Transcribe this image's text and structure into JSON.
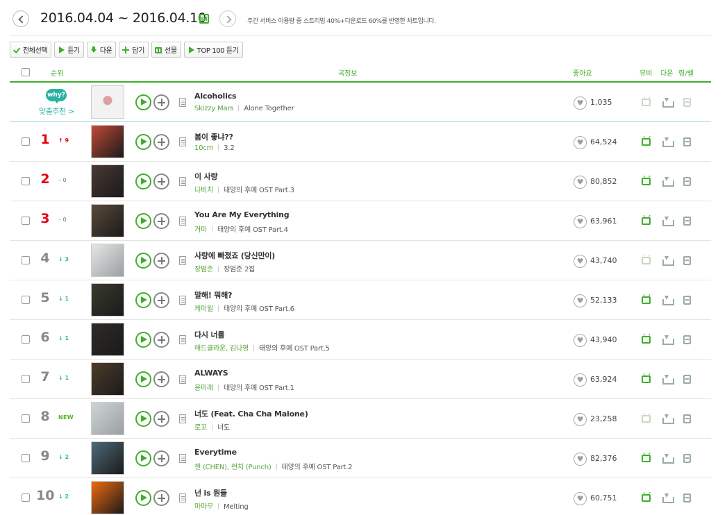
{
  "header": {
    "date_range": "2016.04.04 ~ 2016.04.10",
    "notice": "주간 서비스 이용량 중 스트리밍 40%+다운로드 60%를 반영한 차트입니다."
  },
  "toolbar": {
    "select_all": "전체선택",
    "listen": "듣기",
    "download": "다운",
    "add": "담기",
    "gift": "선물",
    "top100": "TOP 100 듣기"
  },
  "columns": {
    "rank": "순위",
    "song_info": "곡정보",
    "likes": "좋아요",
    "mv": "뮤비",
    "download": "다운",
    "ring": "링/벨"
  },
  "recommendation": {
    "why": "why?",
    "label": "맞춤추천 >",
    "title": "Alcoholics",
    "artist": "Skizzy Mars",
    "album": "Alone Together",
    "likes": "1,035",
    "mv_available": false
  },
  "songs": [
    {
      "rank": "1",
      "change": "9",
      "direction": "up",
      "title": "봄이 좋냐??",
      "artist": "10cm",
      "album": "3.2",
      "likes": "64,524",
      "mv_available": true,
      "art_color": "#c14a37"
    },
    {
      "rank": "2",
      "change": "0",
      "direction": "same",
      "title": "이 사랑",
      "artist": "다비치",
      "album": "태양의 후예 OST Part.3",
      "likes": "80,852",
      "mv_available": true,
      "art_color": "#4a3a36"
    },
    {
      "rank": "3",
      "change": "0",
      "direction": "same",
      "title": "You Are My Everything",
      "artist": "거미",
      "album": "태양의 후예 OST Part.4",
      "likes": "63,961",
      "mv_available": true,
      "art_color": "#5b4a3a"
    },
    {
      "rank": "4",
      "change": "3",
      "direction": "down",
      "title": "사랑에 빠졌죠 (당신만이)",
      "artist": "장범준",
      "album": "장범준 2집",
      "likes": "43,740",
      "mv_available": false,
      "art_color": "#e6e6e6"
    },
    {
      "rank": "5",
      "change": "1",
      "direction": "down",
      "title": "말해! 뭐해?",
      "artist": "케이윌",
      "album": "태양의 후예 OST Part.6",
      "likes": "52,133",
      "mv_available": true,
      "art_color": "#3a3a2e"
    },
    {
      "rank": "6",
      "change": "1",
      "direction": "down",
      "title": "다시 너를",
      "artist": "매드클라운, 김나영",
      "album": "태양의 후예 OST Part.5",
      "likes": "43,940",
      "mv_available": true,
      "art_color": "#2f2b28"
    },
    {
      "rank": "7",
      "change": "1",
      "direction": "down",
      "title": "ALWAYS",
      "artist": "윤미래",
      "album": "태양의 후예 OST Part.1",
      "likes": "63,924",
      "mv_available": true,
      "art_color": "#4d3d2a"
    },
    {
      "rank": "8",
      "change": "NEW",
      "direction": "new",
      "title": "너도 (Feat. Cha Cha Malone)",
      "artist": "로꼬",
      "album": "너도",
      "likes": "23,258",
      "mv_available": false,
      "art_color": "#cfd4d6"
    },
    {
      "rank": "9",
      "change": "2",
      "direction": "down",
      "title": "Everytime",
      "artist": "첸 (CHEN), 펀치 (Punch)",
      "album": "태양의 후예 OST Part.2",
      "likes": "82,376",
      "mv_available": true,
      "art_color": "#4e6a7a"
    },
    {
      "rank": "10",
      "change": "2",
      "direction": "down",
      "title": "넌 is 뭔들",
      "artist": "마마무",
      "album": "Melting",
      "likes": "60,751",
      "mv_available": true,
      "art_color": "#f06a10"
    }
  ]
}
